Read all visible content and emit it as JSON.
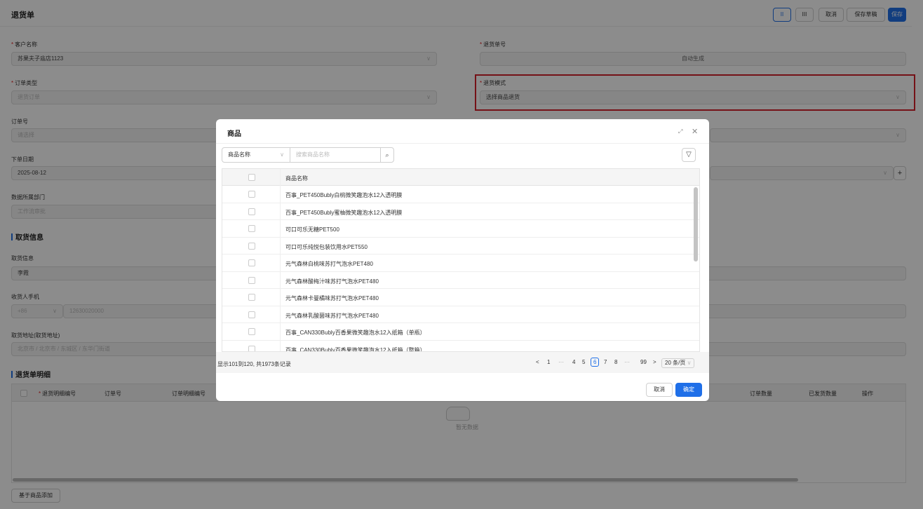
{
  "header": {
    "title": "退货单",
    "btn_pause": "II",
    "btn_bars": "III",
    "btn_cancel": "取消",
    "btn_draft": "保存草稿",
    "btn_save": "保存"
  },
  "form": {
    "customer": {
      "label": "客户名称",
      "value": "苏果夫子庙店1123"
    },
    "return_no": {
      "label": "退货单号",
      "value": "自动生成"
    },
    "order_type": {
      "label": "订单类型",
      "placeholder": "退货订单"
    },
    "return_mode": {
      "label": "退货模式",
      "value": "选择商品退货"
    },
    "order_no": {
      "label": "订单号",
      "placeholder": "请选择"
    },
    "order_date": {
      "label": "下单日期",
      "value": "2025-08-12"
    },
    "dept": {
      "label": "数据所属部门",
      "placeholder": "工作流审批"
    }
  },
  "pickup": {
    "section": "取货信息",
    "info_label": "取货信息",
    "info_value": "李霞",
    "phone_label": "收货人手机",
    "phone_code": "+86",
    "phone_value": "12630020000",
    "addr_label": "取货地址(取货地址)",
    "addr_value": "北京市 / 北京市 / 东城区 / 东华门街道"
  },
  "detail": {
    "section": "退货单明细",
    "cols": {
      "line_no": "退货明细编号",
      "order_no": "订单号",
      "order_line": "订单明细编号",
      "order_qty": "订单数量",
      "shipped_qty": "已发货数量",
      "ops": "操作"
    },
    "empty": "暂无数据",
    "add_btn": "基于商品添加"
  },
  "modal": {
    "title": "商品",
    "filter_field": "商品名称",
    "search_placeholder": "搜索商品名称",
    "col_name": "商品名称",
    "rows": [
      "百事_PET450Bubly白桃微笑趣泡水12入透明膜",
      "百事_PET450Bubly蜜柚微笑趣泡水12入透明膜",
      "可口可乐无糖PET500",
      "可口可乐纯悦包装饮用水PET550",
      "元气森林白桃味苏打气泡水PET480",
      "元气森林酸梅汁味苏打气泡水PET480",
      "元气森林卡曼橘味苏打气泡水PET480",
      "元气森林乳酸菌味苏打气泡水PET480",
      "百事_CAN330Bubly百香果微笑趣泡水12入纸箱（单瓶）",
      "百事_CAN330Bubly百香果微笑趣泡水12入纸箱（整箱）"
    ],
    "footer_text": "显示101到120, 共1973条记录",
    "pager": {
      "prev": "<",
      "p1": "1",
      "dots1": "···",
      "p4": "4",
      "p5": "5",
      "p6": "6",
      "p7": "7",
      "p8": "8",
      "dots2": "···",
      "p99": "99",
      "next": ">",
      "size": "20 条/页"
    },
    "cancel": "取消",
    "ok": "确定"
  },
  "colors": {
    "primary": "#1f6fe8",
    "highlight": "#d6202a"
  }
}
